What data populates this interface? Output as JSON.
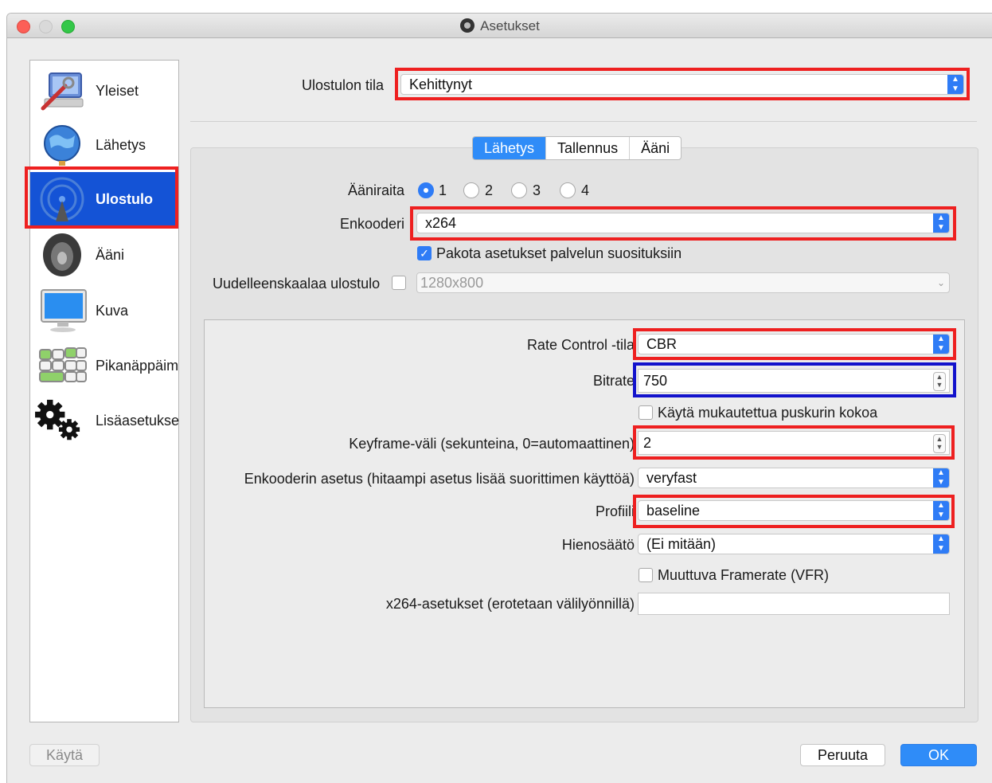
{
  "window": {
    "title": "Asetukset"
  },
  "sidebar": {
    "items": [
      {
        "label": "Yleiset",
        "icon": "general-settings-icon"
      },
      {
        "label": "Lähetys",
        "icon": "globe-icon"
      },
      {
        "label": "Ulostulo",
        "icon": "broadcast-icon",
        "active": true
      },
      {
        "label": "Ääni",
        "icon": "speaker-icon"
      },
      {
        "label": "Kuva",
        "icon": "monitor-icon"
      },
      {
        "label": "Pikanäppäim",
        "icon": "keyboard-icon"
      },
      {
        "label": "Lisäasetukse",
        "icon": "gears-icon"
      }
    ]
  },
  "output_mode": {
    "label": "Ulostulon tila",
    "value": "Kehittynyt"
  },
  "tabs": [
    {
      "label": "Lähetys",
      "active": true
    },
    {
      "label": "Tallennus"
    },
    {
      "label": "Ääni"
    }
  ],
  "audio_track": {
    "label": "Ääniraita",
    "options": [
      "1",
      "2",
      "3",
      "4"
    ],
    "selected": "1"
  },
  "encoder": {
    "label": "Enkooderi",
    "value": "x264"
  },
  "enforce": {
    "label": "Pakota asetukset palvelun suosituksiin",
    "checked": true
  },
  "rescale": {
    "label": "Uudelleenskaalaa ulostulo",
    "value": "1280x800",
    "checked": false
  },
  "rate_control": {
    "label": "Rate Control -tila",
    "value": "CBR"
  },
  "bitrate": {
    "label": "Bitrate",
    "value": "750"
  },
  "custom_buffer": {
    "label": "Käytä mukautettua puskurin kokoa",
    "checked": false
  },
  "keyframe": {
    "label": "Keyframe-väli (sekunteina, 0=automaattinen)",
    "value": "2"
  },
  "preset": {
    "label": "Enkooderin asetus (hitaampi asetus lisää suorittimen käyttöä)",
    "value": "veryfast"
  },
  "profile": {
    "label": "Profiili",
    "value": "baseline"
  },
  "tune": {
    "label": "Hienosäätö",
    "value": "(Ei mitään)"
  },
  "vfr": {
    "label": "Muuttuva Framerate (VFR)",
    "checked": false
  },
  "x264_opts": {
    "label": "x264-asetukset (erotetaan välilyönnillä)",
    "value": ""
  },
  "footer": {
    "apply": "Käytä",
    "cancel": "Peruuta",
    "ok": "OK"
  },
  "colors": {
    "accent": "#2f7cf6",
    "highlight_red": "#ee2020",
    "highlight_blue": "#1212cc",
    "sidebar_active": "#1453d6"
  }
}
